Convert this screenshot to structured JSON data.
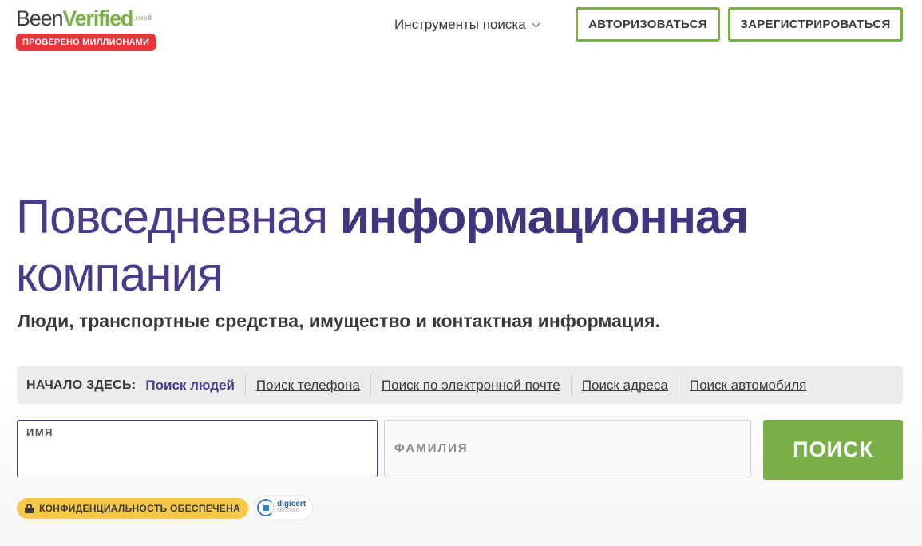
{
  "header": {
    "logo": {
      "part1": "Been",
      "part2": "Verified",
      "suffix": ".com",
      "reg": "®",
      "badge": "ПРОВЕРЕНО МИЛЛИОНАМИ"
    },
    "nav_tools_label": "Инструменты поиска",
    "login_label": "АВТОРИЗОВАТЬСЯ",
    "register_label": "ЗАРЕГИСТРИРОВАТЬСЯ"
  },
  "hero": {
    "headline_light": "Повседневная ",
    "headline_bold": "информационная",
    "headline_line2": "компания",
    "subheadline": "Люди, транспортные средства, имущество и контактная информация."
  },
  "search": {
    "start_label": "НАЧАЛО ЗДЕСЬ:",
    "tabs": [
      {
        "label": "Поиск людей",
        "active": true
      },
      {
        "label": "Поиск телефона",
        "active": false
      },
      {
        "label": "Поиск по электронной почте",
        "active": false
      },
      {
        "label": "Поиск адреса",
        "active": false
      },
      {
        "label": "Поиск автомобиля",
        "active": false
      }
    ],
    "first_name_label": "ИМЯ",
    "first_name_value": "",
    "last_name_placeholder": "ФАМИЛИЯ",
    "last_name_value": "",
    "submit_label": "ПОИСК"
  },
  "trust": {
    "privacy_label": "КОНФИДЕНЦИАЛЬНОСТЬ ОБЕСПЕЧЕНА",
    "digicert_name": "digicert",
    "digicert_sub": "SECURED"
  },
  "colors": {
    "brand_green": "#7ab04a",
    "brand_purple": "#4b3a8c",
    "badge_red": "#e8323c",
    "privacy_yellow": "#f5c84a"
  }
}
